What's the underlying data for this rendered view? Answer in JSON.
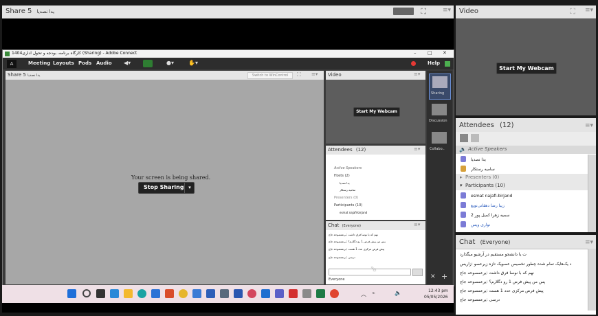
{
  "outer": {
    "share_title": "Share 5",
    "share_subtitle": "یدا نصدیا",
    "video_title": "Video",
    "webcam_btn": "Start My Webcam",
    "attendees_title": "Attendees",
    "attendees_count": "(12)",
    "active_speakers": "Active Speakers",
    "attendees_rows": [
      "یدا نصدیا",
      "سامیه رستکار"
    ],
    "presenters": "Presenters (0)",
    "participants": "Participants (10)",
    "participants_list": [
      "esmat najafi-birjand",
      "زیبا رضا دهقانی‌نوبع",
      "سمیه زهرا کمیل پور 2",
      "نواری ویس"
    ],
    "chat_title": "Chat",
    "chat_scope": "(Everyone)",
    "chat_messages": [
      "ت یا دانشجو مستقیم در آرشیو میگذارد",
      "د یک‌هایک تمام شده چطور تخصیص عصویک تازه زیرعصو :زاریس",
      "نهم که با نوسا فرق داشت :یرعمصوحه جاج",
      "پس من پیش فرض 1 رو دگلارم؟ :یرعمصوحه جاج",
      "پیش فرض مرکزی عدد 1 هست :یرعمصوحه جاج",
      "درسی :یرعمصوحه جاج"
    ]
  },
  "inner": {
    "window_title": "کارگاه برنامه، بودجه و تحول اداری1404 (Sharing) - Adobe Connect",
    "menus": [
      "Meeting",
      "Layouts",
      "Pods",
      "Audio"
    ],
    "help": "Help",
    "share_title": "Share 5",
    "share_subtitle": "یدا نصدیا",
    "switch_btn": "Switch to WinControl",
    "sharing_msg": "Your screen is being shared.",
    "stop_btn": "Stop Sharing",
    "video_title": "Video",
    "webcam_btn": "Start My Webcam",
    "attendees_title": "Attendees",
    "attendees_count": "(12)",
    "active_speakers": "Active Speakers",
    "hosts": "Hosts (2)",
    "host_rows": [
      "یدا نصدیا",
      "سامیه رستکار"
    ],
    "presenters": "Presenters (0)",
    "participants": "Participants (10)",
    "participant_row": "esmat najafi-birjand",
    "chat_title": "Chat",
    "chat_scope": "(Everyone)",
    "chat_messages": [
      "نهم که با نوسا فرق داشت :یرعمصوحه جاج",
      "پس من پیش فرض 1 رو دگلارم؟ :یرعمصوحه جاج",
      "پیش فرض مرکزی عدد 1 هست :یرعمصوحه جاج",
      "درسی :یرعمصوحه جاج"
    ],
    "chat_tab": "Everyone",
    "layouts": [
      "Sharing",
      "Discussion",
      "Collabo.."
    ]
  },
  "taskbar": {
    "time": "12:43 pm",
    "date": "05/05/2026"
  }
}
